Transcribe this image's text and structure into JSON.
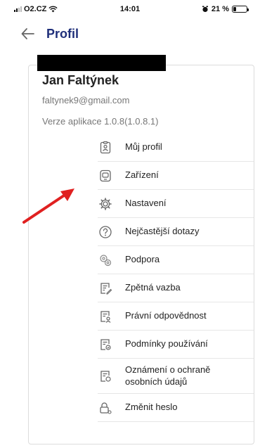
{
  "status_bar": {
    "carrier": "O2.CZ",
    "time": "14:01",
    "battery_percent": "21 %",
    "battery_level": 0.21
  },
  "header": {
    "title": "Profil",
    "back_icon": "arrow-left-icon"
  },
  "profile": {
    "name": "Jan Faltýnek",
    "email": "faltynek9@gmail.com",
    "app_version": "Verze aplikace 1.0.8(1.0.8.1)"
  },
  "menu": {
    "items": [
      {
        "label": "Můj profil",
        "icon": "id-badge-icon"
      },
      {
        "label": "Zařízení",
        "icon": "device-icon"
      },
      {
        "label": "Nastavení",
        "icon": "gear-icon"
      },
      {
        "label": "Nejčastější dotazy",
        "icon": "question-circle-icon"
      },
      {
        "label": "Podpora",
        "icon": "support-gears-icon"
      },
      {
        "label": "Zpětná vazba",
        "icon": "feedback-document-icon"
      },
      {
        "label": "Právní odpovědnost",
        "icon": "legal-document-icon"
      },
      {
        "label": "Podmínky používání",
        "icon": "terms-document-icon"
      },
      {
        "label_line1": "Oznámení o ochraně",
        "label_line2": "osobních údajů",
        "icon": "privacy-document-icon"
      },
      {
        "label": "Změnit heslo",
        "icon": "lock-icon"
      }
    ]
  },
  "colors": {
    "title": "#1f2f7a",
    "annotation_arrow": "#e02020",
    "icon": "#666666"
  }
}
